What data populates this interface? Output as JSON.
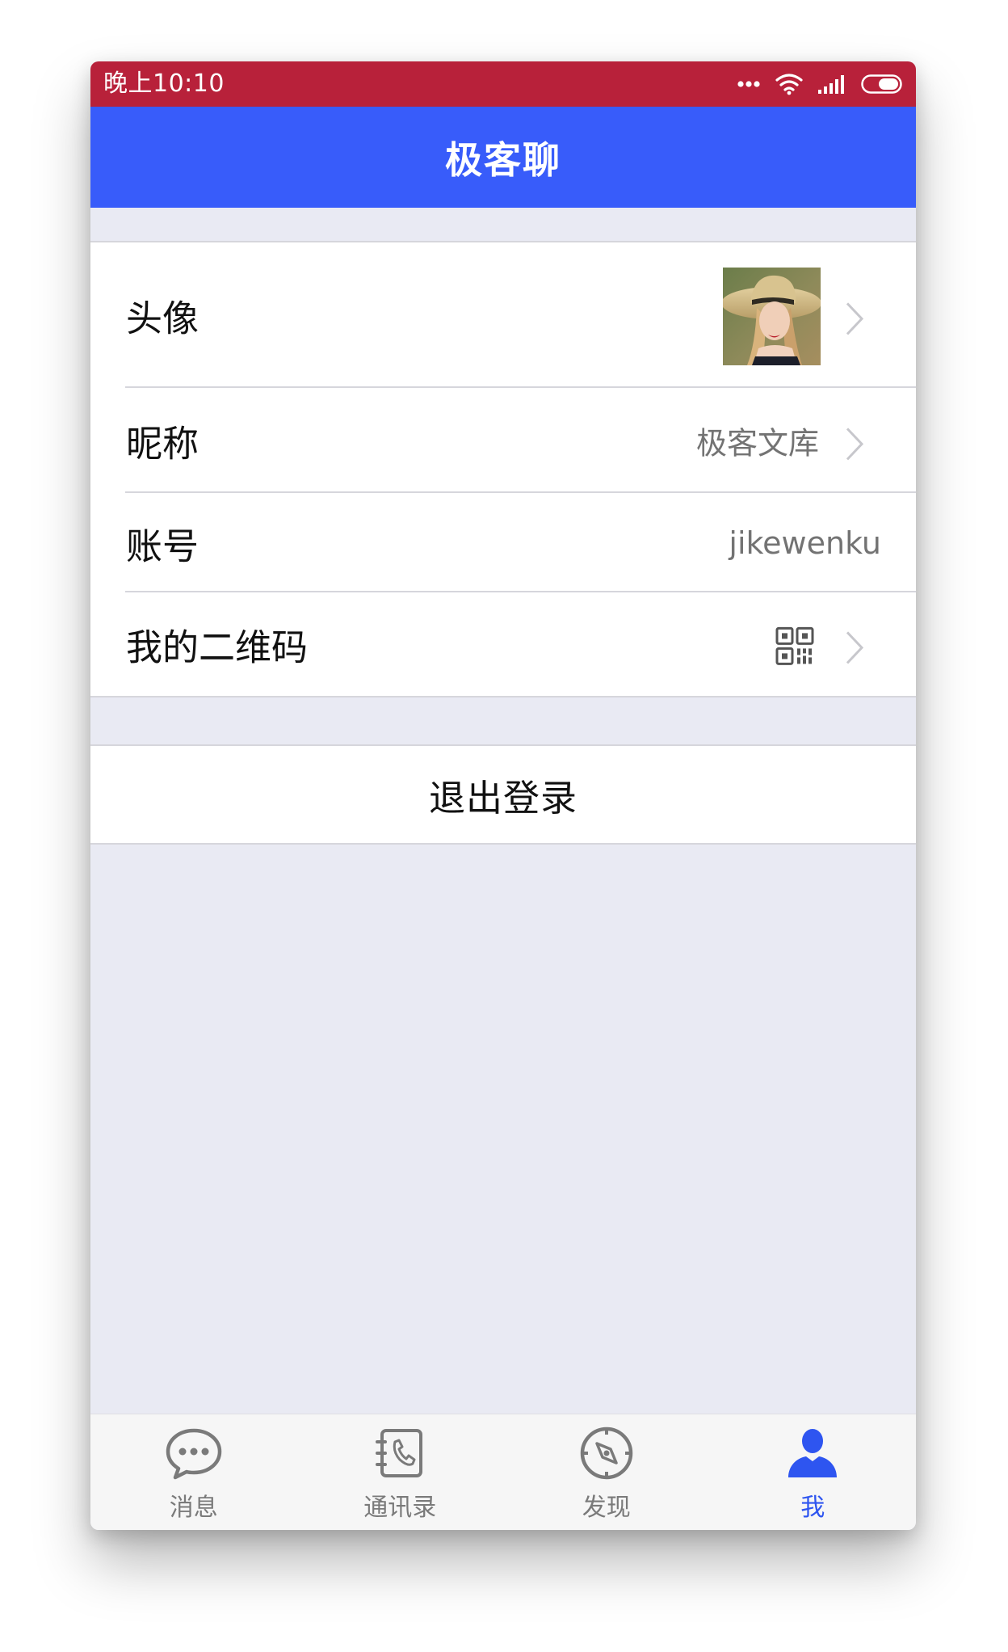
{
  "status_bar": {
    "time": "晚上10:10",
    "icons": [
      "more-dots-icon",
      "wifi-icon",
      "signal-icon",
      "battery-icon"
    ],
    "background": "#b8213a"
  },
  "nav": {
    "title": "极客聊",
    "background": "#385cfa"
  },
  "profile": {
    "avatar_label": "头像",
    "avatar_image": "portrait of a woman in a straw hat",
    "nickname_label": "昵称",
    "nickname_value": "极客文库",
    "account_label": "账号",
    "account_value": "jikewenku",
    "qrcode_label": "我的二维码",
    "qrcode_icon": "qr-code-icon"
  },
  "logout": {
    "label": "退出登录"
  },
  "tab_bar": {
    "tabs": [
      {
        "label": "消息",
        "icon": "chat-bubble-icon",
        "active": false
      },
      {
        "label": "通讯录",
        "icon": "contacts-book-icon",
        "active": false
      },
      {
        "label": "发现",
        "icon": "compass-icon",
        "active": false
      },
      {
        "label": "我",
        "icon": "person-icon",
        "active": true
      }
    ],
    "active_color": "#2e55f0",
    "inactive_color": "#7a7a7a"
  }
}
